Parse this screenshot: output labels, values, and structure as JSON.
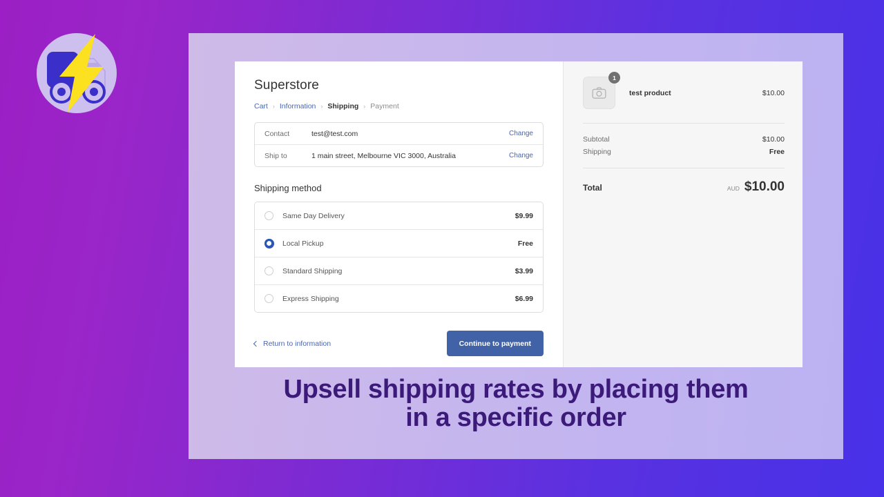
{
  "brand": {
    "logo_icon": "delivery-truck-lightning-logo"
  },
  "checkout": {
    "shop_title": "Superstore",
    "breadcrumb": [
      {
        "label": "Cart",
        "state": "link"
      },
      {
        "label": "Information",
        "state": "link"
      },
      {
        "label": "Shipping",
        "state": "current"
      },
      {
        "label": "Payment",
        "state": "next"
      }
    ],
    "breadcrumb_separator": "›",
    "info_rows": [
      {
        "label": "Contact",
        "value": "test@test.com",
        "action": "Change"
      },
      {
        "label": "Ship to",
        "value": "1 main street, Melbourne VIC 3000, Australia",
        "action": "Change"
      }
    ],
    "shipping_section_title": "Shipping method",
    "shipping_methods": [
      {
        "name": "Same Day Delivery",
        "price": "$9.99",
        "selected": false
      },
      {
        "name": "Local Pickup",
        "price": "Free",
        "selected": true
      },
      {
        "name": "Standard Shipping",
        "price": "$3.99",
        "selected": false
      },
      {
        "name": "Express Shipping",
        "price": "$6.99",
        "selected": false
      }
    ],
    "return_link": "Return to information",
    "continue_button": "Continue to payment"
  },
  "summary": {
    "items": [
      {
        "name": "test product",
        "price": "$10.00",
        "qty": "1",
        "thumb_icon": "camera-placeholder-icon"
      }
    ],
    "subtotal_label": "Subtotal",
    "subtotal_value": "$10.00",
    "shipping_label": "Shipping",
    "shipping_value": "Free",
    "total_label": "Total",
    "total_currency": "AUD",
    "total_value": "$10.00"
  },
  "caption": {
    "line1": "Upsell shipping rates by placing them",
    "line2": "in a specific order"
  },
  "colors": {
    "accent_button": "#4262a8",
    "link": "#4b66b0",
    "radio_selected": "#2b56b5",
    "caption_text": "#3b1a7a",
    "bg_gradient_start": "#9b1fc4",
    "bg_gradient_end": "#4731e8",
    "panel_start": "#cfbbe8",
    "panel_end": "#bcb2f2"
  }
}
